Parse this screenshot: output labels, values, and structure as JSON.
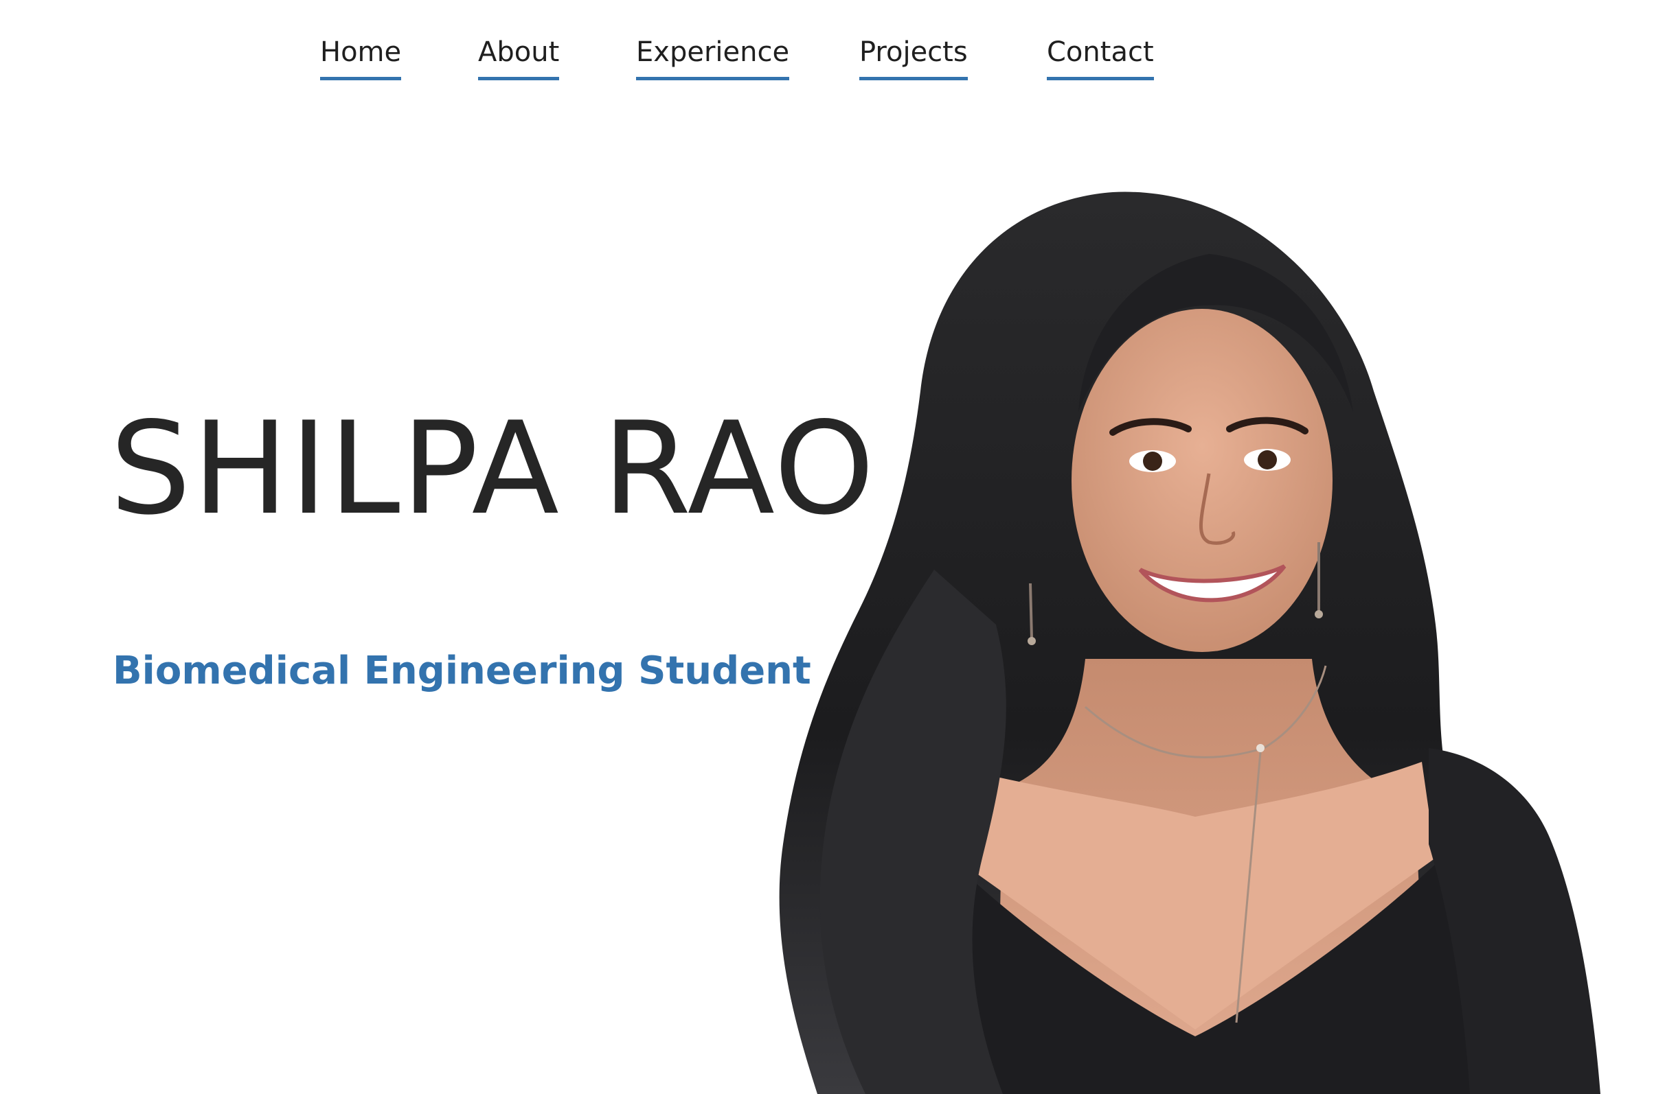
{
  "nav": {
    "items": [
      {
        "label": "Home"
      },
      {
        "label": "About"
      },
      {
        "label": "Experience"
      },
      {
        "label": "Projects"
      },
      {
        "label": "Contact"
      }
    ]
  },
  "hero": {
    "name": "SHILPA RAO",
    "subtitle": "Biomedical Engineering Student"
  },
  "colors": {
    "accent": "#3373ae",
    "text": "#262626",
    "background": "#ffffff"
  }
}
